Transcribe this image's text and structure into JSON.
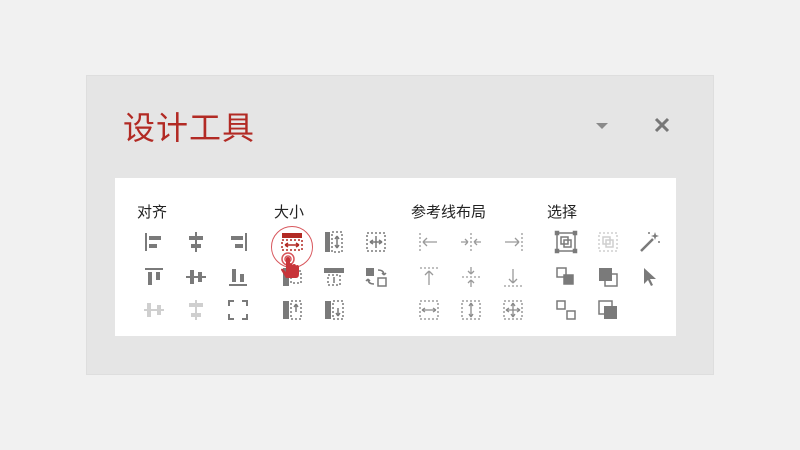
{
  "panel": {
    "title": "设计工具",
    "dropdown_icon": "chevron-down-icon",
    "close_icon": "close-icon"
  },
  "groups": [
    {
      "label": "对齐",
      "icons": [
        "align-left-icon",
        "align-center-icon",
        "align-right-icon",
        "align-top-icon",
        "align-middle-icon",
        "align-bottom-icon",
        "distribute-horizontal-icon",
        "distribute-vertical-icon",
        "align-to-page-icon"
      ]
    },
    {
      "label": "大小",
      "icons": [
        "same-width-icon",
        "same-height-icon",
        "same-size-icon",
        "match-width-icon",
        "match-height-icon",
        "swap-size-icon",
        "stretch-top-icon",
        "stretch-bottom-icon"
      ]
    },
    {
      "label": "参考线布局",
      "icons": [
        "guide-left-icon",
        "guide-center-icon",
        "guide-right-icon",
        "guide-top-icon",
        "guide-middle-icon",
        "guide-bottom-icon",
        "guide-horizontal-frame-icon",
        "guide-vertical-frame-icon",
        "guide-grid-icon"
      ]
    },
    {
      "label": "选择",
      "icons": [
        "select-same-icon",
        "select-group-icon",
        "magic-wand-icon",
        "send-backward-icon",
        "bring-forward-icon",
        "pointer-icon",
        "layer-down-icon",
        "layer-up-icon"
      ]
    }
  ],
  "colors": {
    "accent": "#b22a24",
    "icon": "#7a7a7a",
    "icon_disabled": "#cfcfcf",
    "selection": "#d8565c"
  }
}
